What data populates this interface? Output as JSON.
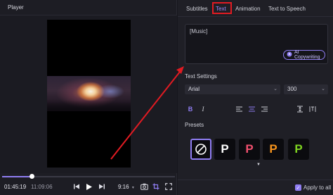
{
  "player": {
    "title": "Player",
    "current_time": "01:45:19",
    "total_time": "11:09:06",
    "aspect_ratio": "9:16",
    "progress": 0.17
  },
  "editor": {
    "tabs": [
      {
        "label": "Subtitles",
        "active": false
      },
      {
        "label": "Text",
        "active": true
      },
      {
        "label": "Animation",
        "active": false
      },
      {
        "label": "Text to Speech",
        "active": false
      }
    ],
    "text_value": "[Music]",
    "ai_button_label": "AI Copywriting",
    "text_settings_label": "Text Settings",
    "font_select_value": "Arial",
    "size_select_value": "300",
    "presets_label": "Presets",
    "presets": [
      {
        "glyph": "P",
        "color": "#ffffff"
      },
      {
        "glyph": "P",
        "color": "#f0506e"
      },
      {
        "glyph": "P",
        "color": "#f7941d"
      },
      {
        "glyph": "P",
        "color": "#7ed321"
      }
    ],
    "apply_to_all_label": "Apply to all",
    "apply_to_all_checked": true
  },
  "colors": {
    "accent": "#8f7df2",
    "highlight": "#e11b22"
  }
}
